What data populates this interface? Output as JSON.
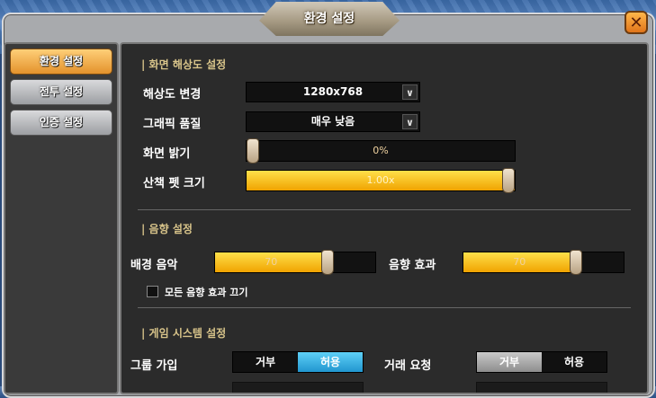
{
  "window": {
    "title": "환경 설정",
    "close_icon": "close-icon"
  },
  "sidebar": {
    "items": [
      {
        "label": "환경 설정",
        "active": true
      },
      {
        "label": "전투 설정",
        "active": false
      },
      {
        "label": "인증 설정",
        "active": false
      }
    ]
  },
  "display": {
    "section_title": "| 화면 해상도 설정",
    "resolution": {
      "label": "해상도 변경",
      "value": "1280x768"
    },
    "graphics": {
      "label": "그래픽 품질",
      "value": "매우 낮음"
    },
    "brightness": {
      "label": "화면 밝기",
      "value": "0%",
      "level": 0
    },
    "pet_size": {
      "label": "산책 펫 크기",
      "value": "1.00x",
      "level": 1.0
    }
  },
  "sound": {
    "section_title": "| 음향 설정",
    "bgm": {
      "label": "배경 음악",
      "value": "70",
      "level": 0.7
    },
    "sfx": {
      "label": "음향 효과",
      "value": "70",
      "level": 0.7
    },
    "mute_all": {
      "label": "모든 음향 효과 끄기",
      "checked": false
    }
  },
  "system": {
    "section_title": "| 게임 시스템 설정",
    "group_join": {
      "label": "그룹 가입",
      "options": [
        "거부",
        "허용"
      ],
      "selected": "허용"
    },
    "trade_request": {
      "label": "거래 요청",
      "options": [
        "거부",
        "허용"
      ],
      "selected": "거부"
    }
  },
  "colors": {
    "accent": "#f0a300",
    "toggle_on": "#2196cf",
    "section_title": "#d8c48a"
  }
}
